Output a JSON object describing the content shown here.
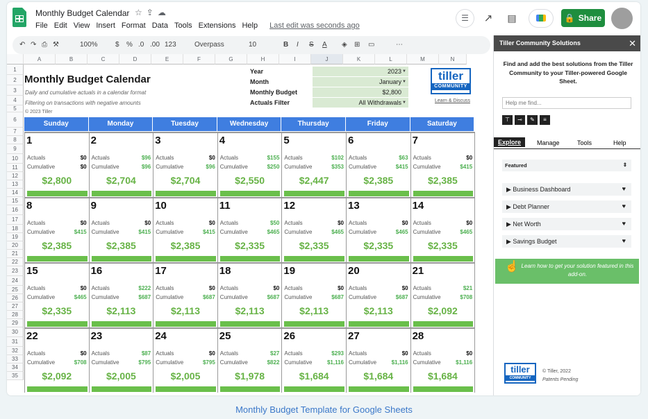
{
  "doc": {
    "title": "Monthly Budget Calendar",
    "menu": [
      "File",
      "Edit",
      "View",
      "Insert",
      "Format",
      "Data",
      "Tools",
      "Extensions",
      "Help"
    ],
    "last_edit": "Last edit was seconds ago",
    "share_label": "Share"
  },
  "toolbar": {
    "zoom": "100%",
    "currency": "$",
    "percent": "%",
    "dec_less": ".0",
    "dec_more": ".00",
    "format": "123",
    "font": "Overpass",
    "size": "10",
    "bold": "B",
    "italic": "I",
    "strike": "S",
    "textcolor": "A",
    "more": "⋯"
  },
  "columns": [
    "A",
    "B",
    "C",
    "D",
    "E",
    "F",
    "G",
    "H",
    "I",
    "J",
    "K",
    "L",
    "M",
    "N"
  ],
  "rows": [
    "1",
    "2",
    "3",
    "4",
    "5",
    "6",
    "7",
    "8",
    "9",
    "10",
    "11",
    "12",
    "13",
    "14",
    "15",
    "16",
    "17",
    "18",
    "19",
    "20",
    "21",
    "22",
    "23",
    "24",
    "25",
    "26",
    "27",
    "28",
    "29",
    "30",
    "31",
    "32",
    "33",
    "34",
    "35"
  ],
  "header": {
    "title": "Monthly Budget Calendar",
    "sub1": "Daily and cumulative actuals in a calendar format",
    "sub2": "Filtering on transactions with negative amounts",
    "copyright": "© 2023 Tiller"
  },
  "params": [
    {
      "label": "Year",
      "value": "2023"
    },
    {
      "label": "Month",
      "value": "January"
    },
    {
      "label": "Monthly Budget",
      "value": "$2,800"
    },
    {
      "label": "Actuals Filter",
      "value": "All Withdrawals"
    }
  ],
  "brand": {
    "name": "tiller",
    "tag": "COMMUNITY",
    "learn": "Learn & Discuss"
  },
  "days": [
    "Sunday",
    "Monday",
    "Tuesday",
    "Wednesday",
    "Thursday",
    "Friday",
    "Saturday"
  ],
  "labels": {
    "actuals": "Actuals",
    "cumulative": "Cumulative"
  },
  "weeks": [
    [
      {
        "d": "1",
        "a": "$0",
        "c": "$0",
        "r": "$2,800"
      },
      {
        "d": "2",
        "a": "$96",
        "c": "$96",
        "r": "$2,704"
      },
      {
        "d": "3",
        "a": "$0",
        "c": "$96",
        "r": "$2,704"
      },
      {
        "d": "4",
        "a": "$155",
        "c": "$250",
        "r": "$2,550"
      },
      {
        "d": "5",
        "a": "$102",
        "c": "$353",
        "r": "$2,447"
      },
      {
        "d": "6",
        "a": "$63",
        "c": "$415",
        "r": "$2,385"
      },
      {
        "d": "7",
        "a": "$0",
        "c": "$415",
        "r": "$2,385"
      }
    ],
    [
      {
        "d": "8",
        "a": "$0",
        "c": "$415",
        "r": "$2,385"
      },
      {
        "d": "9",
        "a": "$0",
        "c": "$415",
        "r": "$2,385"
      },
      {
        "d": "10",
        "a": "$0",
        "c": "$415",
        "r": "$2,385"
      },
      {
        "d": "11",
        "a": "$50",
        "c": "$465",
        "r": "$2,335"
      },
      {
        "d": "12",
        "a": "$0",
        "c": "$465",
        "r": "$2,335"
      },
      {
        "d": "13",
        "a": "$0",
        "c": "$465",
        "r": "$2,335"
      },
      {
        "d": "14",
        "a": "$0",
        "c": "$465",
        "r": "$2,335"
      }
    ],
    [
      {
        "d": "15",
        "a": "$0",
        "c": "$465",
        "r": "$2,335"
      },
      {
        "d": "16",
        "a": "$222",
        "c": "$687",
        "r": "$2,113"
      },
      {
        "d": "17",
        "a": "$0",
        "c": "$687",
        "r": "$2,113"
      },
      {
        "d": "18",
        "a": "$0",
        "c": "$687",
        "r": "$2,113"
      },
      {
        "d": "19",
        "a": "$0",
        "c": "$687",
        "r": "$2,113"
      },
      {
        "d": "20",
        "a": "$0",
        "c": "$687",
        "r": "$2,113"
      },
      {
        "d": "21",
        "a": "$21",
        "c": "$708",
        "r": "$2,092"
      }
    ],
    [
      {
        "d": "22",
        "a": "$0",
        "c": "$708",
        "r": "$2,092"
      },
      {
        "d": "23",
        "a": "$87",
        "c": "$795",
        "r": "$2,005"
      },
      {
        "d": "24",
        "a": "$0",
        "c": "$795",
        "r": "$2,005"
      },
      {
        "d": "25",
        "a": "$27",
        "c": "$822",
        "r": "$1,978"
      },
      {
        "d": "26",
        "a": "$293",
        "c": "$1,116",
        "r": "$1,684"
      },
      {
        "d": "27",
        "a": "$0",
        "c": "$1,116",
        "r": "$1,684"
      },
      {
        "d": "28",
        "a": "$0",
        "c": "$1,116",
        "r": "$1,684"
      }
    ]
  ],
  "panel": {
    "title": "Tiller Community Solutions",
    "intro": "Find and add the best solutions from the Tiller Community to your Tiller-powered Google Sheet.",
    "search_placeholder": "Help me find...",
    "tabs": [
      "Explore",
      "Manage",
      "Tools",
      "Help"
    ],
    "filter": "Featured",
    "items": [
      "Business Dashboard",
      "Debt Planner",
      "Net Worth",
      "Savings Budget"
    ],
    "banner": "Learn how to get your solution featured in this add-on.",
    "footer1": "© Tiller, 2022",
    "footer2": "Patents Pending"
  },
  "caption": "Monthly Budget Template for Google Sheets",
  "colors": {
    "header_blue": "#3f7ee0",
    "green": "#6abf4b",
    "share": "#1e8e3e"
  }
}
